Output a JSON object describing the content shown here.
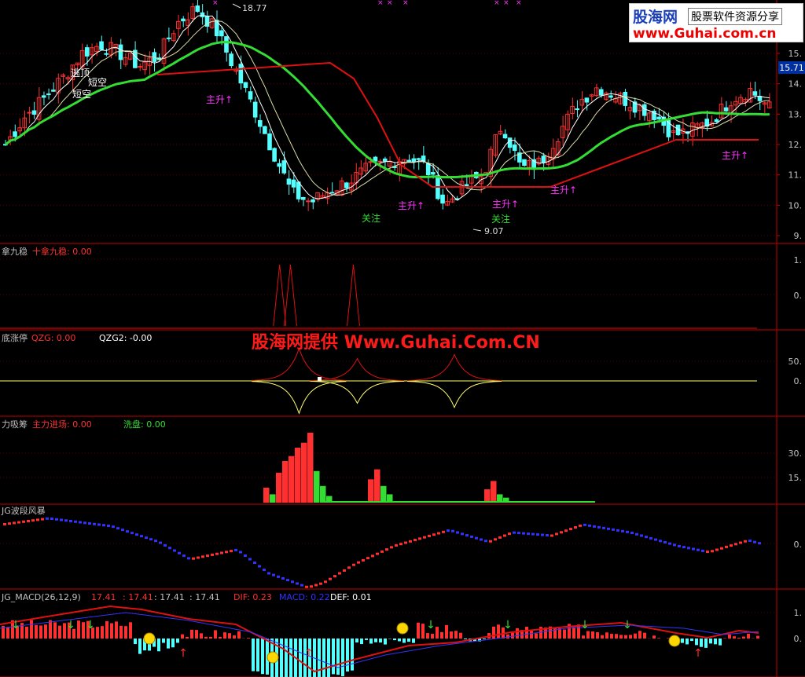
{
  "watermark": {
    "brand": "股海网",
    "tagline": "股票软件资源分享",
    "url": "www.Guhai.com.cn",
    "center_text": "股海网提供 Www.Guhai.Com.CN"
  },
  "colors": {
    "up": "#ff3030",
    "down": "#54ffff",
    "ma_green": "#33dd33",
    "ma_red": "#dd1111",
    "white": "#ffffff",
    "yellow": "#ffff66",
    "axis": "#c00000",
    "magenta": "#ff33ff",
    "blue": "#3333ff"
  },
  "chart_data": [
    {
      "type": "candlestick",
      "panel": "price",
      "price_tag": "15.71",
      "ylim": [
        9,
        16.5
      ],
      "y_ticks": [
        "15.",
        "14.",
        "13.",
        "12.",
        "11.",
        "10.",
        "9."
      ],
      "high_marker": "18.77",
      "low_marker": "9.07",
      "annotations": [
        "逃顶",
        "短空",
        "短空",
        "主升",
        "关注",
        "主升",
        "主升",
        "关注",
        "主升",
        "主升"
      ],
      "close_path": [
        12.0,
        12.9,
        13.5,
        14.2,
        15.0,
        15.3,
        15.0,
        14.6,
        14.9,
        16.0,
        16.5,
        15.8,
        14.5,
        13.2,
        11.8,
        10.4,
        10.1,
        10.5,
        10.8,
        11.2,
        11.4,
        11.6,
        11.3,
        10.0,
        10.6,
        11.0,
        12.7,
        11.2,
        11.4,
        12.4,
        13.4,
        13.9,
        13.6,
        13.3,
        13.0,
        12.3,
        12.5,
        12.8,
        13.5,
        13.8,
        13.2
      ]
    },
    {
      "type": "line",
      "panel": "十拿九稳",
      "legend": [
        {
          "label": "拿九稳",
          "color": "#c0c0c0"
        },
        {
          "label": "十拿九稳: 0.00",
          "color": "#ff3030"
        }
      ],
      "y_ticks": [
        "1.",
        "0."
      ],
      "peaks": [
        {
          "x": 0.36,
          "value": 1.0
        },
        {
          "x": 0.374,
          "value": 1.0
        },
        {
          "x": 0.455,
          "value": 1.0
        }
      ]
    },
    {
      "type": "line",
      "panel": "QZG",
      "legend": [
        {
          "label": "底涨停",
          "color": "#c0c0c0"
        },
        {
          "label": "QZG: 0.00",
          "color": "#ff3030"
        },
        {
          "label": "QZG2: -0.00",
          "color": "#ffffff"
        }
      ],
      "y_ticks": [
        "50.",
        "0."
      ],
      "spikes": [
        {
          "x": 0.385,
          "value": 55
        },
        {
          "x": 0.46,
          "value": 38
        },
        {
          "x": 0.585,
          "value": 45
        }
      ]
    },
    {
      "type": "bar",
      "panel": "主力吸筹",
      "legend": [
        {
          "label": "力吸筹",
          "color": "#c0c0c0"
        },
        {
          "label": "主力进场: 0.00",
          "color": "#ff3030"
        },
        {
          "label": "洗盘: 0.00",
          "color": "#33dd33"
        }
      ],
      "y_ticks": [
        "30.",
        "15."
      ],
      "red_bars": [
        {
          "i": 0,
          "v": 9
        },
        {
          "i": 2,
          "v": 18
        },
        {
          "i": 3,
          "v": 25
        },
        {
          "i": 4,
          "v": 28
        },
        {
          "i": 5,
          "v": 33
        },
        {
          "i": 6,
          "v": 36
        },
        {
          "i": 7,
          "v": 42
        },
        {
          "i": 19,
          "v": 14
        },
        {
          "i": 20,
          "v": 20
        },
        {
          "i": 38,
          "v": 8
        },
        {
          "i": 39,
          "v": 13
        }
      ],
      "green_bars": [
        {
          "i": 1,
          "v": 5
        },
        {
          "i": 8,
          "v": 19
        },
        {
          "i": 9,
          "v": 10
        },
        {
          "i": 10,
          "v": 4
        },
        {
          "i": 21,
          "v": 10
        },
        {
          "i": 22,
          "v": 5
        },
        {
          "i": 40,
          "v": 5
        },
        {
          "i": 41,
          "v": 3
        }
      ]
    },
    {
      "type": "scatter",
      "panel": "UG波段风暴",
      "legend": [
        {
          "label": "JG波段风暴",
          "color": "#c0c0c0"
        }
      ],
      "y_ticks": [
        "0."
      ]
    },
    {
      "type": "bar",
      "panel": "UG_MACD",
      "legend": [
        {
          "label": "JG_MACD(26,12,9)",
          "color": "#c0c0c0"
        },
        {
          "label": "17.41",
          "color": "#ff3030"
        },
        {
          "label": ": 17.41",
          "color": "#ff3030"
        },
        {
          "label": ": 17.41",
          "color": "#c0c0c0"
        },
        {
          "label": ": 17.41",
          "color": "#c0c0c0"
        },
        {
          "label": "DIF: 0.23",
          "color": "#ff3030"
        },
        {
          "label": "MACD: 0.22",
          "color": "#3333ff"
        },
        {
          "label": "DEF: 0.01",
          "color": "#ffffff"
        }
      ],
      "y_ticks": [
        "1.",
        "0."
      ]
    }
  ]
}
